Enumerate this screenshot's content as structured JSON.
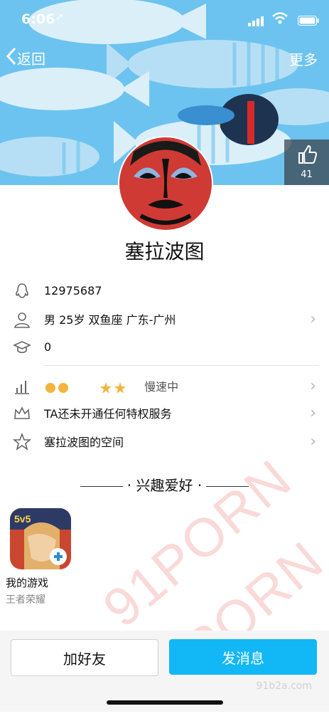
{
  "status_bar": {
    "time": "6:06"
  },
  "nav": {
    "back_label": "返回",
    "more_label": "更多"
  },
  "like": {
    "count": "41"
  },
  "profile": {
    "name": "塞拉波图",
    "qq_number": "12975687",
    "details": "男 25岁 双鱼座 广东-广州",
    "qq_age": "0",
    "level_status": "慢速中",
    "privilege": "TA还未开通任何特权服务",
    "space": "塞拉波图的空间"
  },
  "interests": {
    "title": "兴趣爱好",
    "game_label": "我的游戏",
    "game_name": "王者荣耀",
    "game_icon_badge": "5v5"
  },
  "actions": {
    "add_friend": "加好友",
    "send_message": "发消息"
  },
  "watermarks": {
    "main": "91PORN",
    "small": "91b2a.com"
  },
  "colors": {
    "accent": "#12b7f5",
    "banner": "#6cc3ef"
  }
}
